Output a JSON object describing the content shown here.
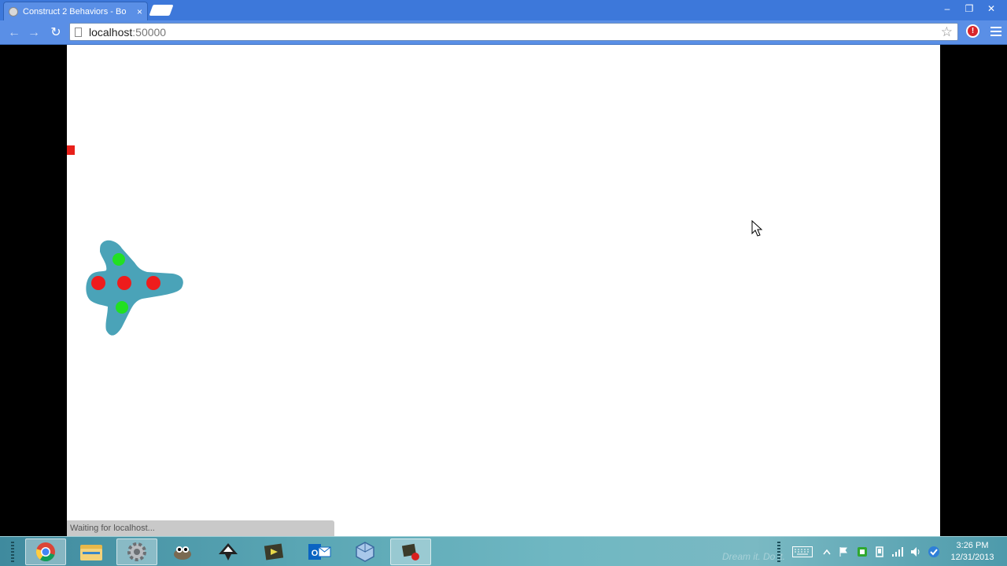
{
  "browser": {
    "tab_title": "Construct 2 Behaviors - Bo",
    "tab_close": "×",
    "window_controls": {
      "minimize": "‒",
      "restore": "❐",
      "close": "✕"
    },
    "nav": {
      "back": "←",
      "forward": "→",
      "reload": "↻"
    },
    "url_host": "localhost",
    "url_port": ":50000",
    "bookmark_star": "☆",
    "extension_icon": "!",
    "menu_icon": "hamburger-menu-icon"
  },
  "page": {
    "status_text": "Waiting for localhost...",
    "colors": {
      "canvas_bg": "#ffffff",
      "ship_body": "#4aa3b8",
      "ship_red_dots": "#ee1c1c",
      "ship_green_dots": "#22e022",
      "bullet": "#e8201a"
    }
  },
  "taskbar": {
    "apps": [
      {
        "name": "chrome-icon",
        "active": true
      },
      {
        "name": "file-explorer-icon",
        "active": false
      },
      {
        "name": "settings-gear-icon",
        "active": true
      },
      {
        "name": "gimp-icon",
        "active": false
      },
      {
        "name": "inkscape-icon",
        "active": false
      },
      {
        "name": "construct2-icon",
        "active": false
      },
      {
        "name": "outlook-icon",
        "active": false
      },
      {
        "name": "virtualbox-icon",
        "active": false
      },
      {
        "name": "recorder-icon",
        "active": true
      }
    ],
    "watermark": "Dream it. Do it.",
    "clock_time": "3:26 PM",
    "clock_date": "12/31/2013"
  }
}
